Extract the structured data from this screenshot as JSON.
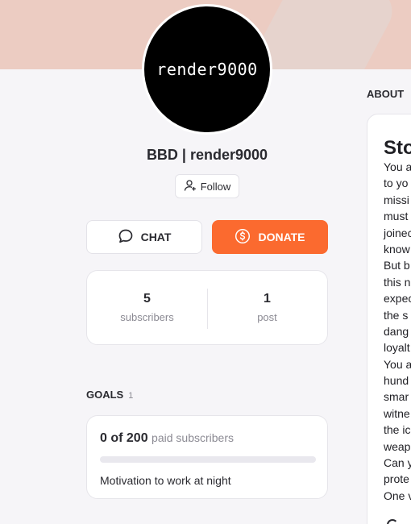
{
  "avatar": {
    "text": "render9000"
  },
  "creator": {
    "name": "BBD | render9000"
  },
  "follow": {
    "label": "Follow",
    "icon": "user-plus-icon"
  },
  "actions": {
    "chat_label": "CHAT",
    "chat_icon": "chat-bubble-icon",
    "donate_label": "DONATE",
    "donate_icon": "coin-dollar-icon"
  },
  "stats": [
    {
      "value": "5",
      "label": "subscribers"
    },
    {
      "value": "1",
      "label": "post"
    }
  ],
  "goals": {
    "title": "GOALS",
    "count": "1",
    "items": [
      {
        "progress_text": "0 of 200",
        "unit": "paid subscribers",
        "progress": 0.0,
        "description": "Motivation to work at night"
      }
    ]
  },
  "about": {
    "title": "ABOUT",
    "story_title": "Sto",
    "lines": [
      "You a",
      "to yo",
      "missi",
      "must",
      "joinec",
      "know",
      "But b",
      "this n",
      "expec",
      "the s",
      "dang",
      "loyalt",
      "You a",
      "hund",
      "smar",
      "witne",
      "the ic",
      "weap",
      "Can y",
      "prote",
      "One v"
    ]
  },
  "colors": {
    "accent": "#fb6a2f",
    "banner": "#ecccc2",
    "background": "#f6f5f8"
  }
}
